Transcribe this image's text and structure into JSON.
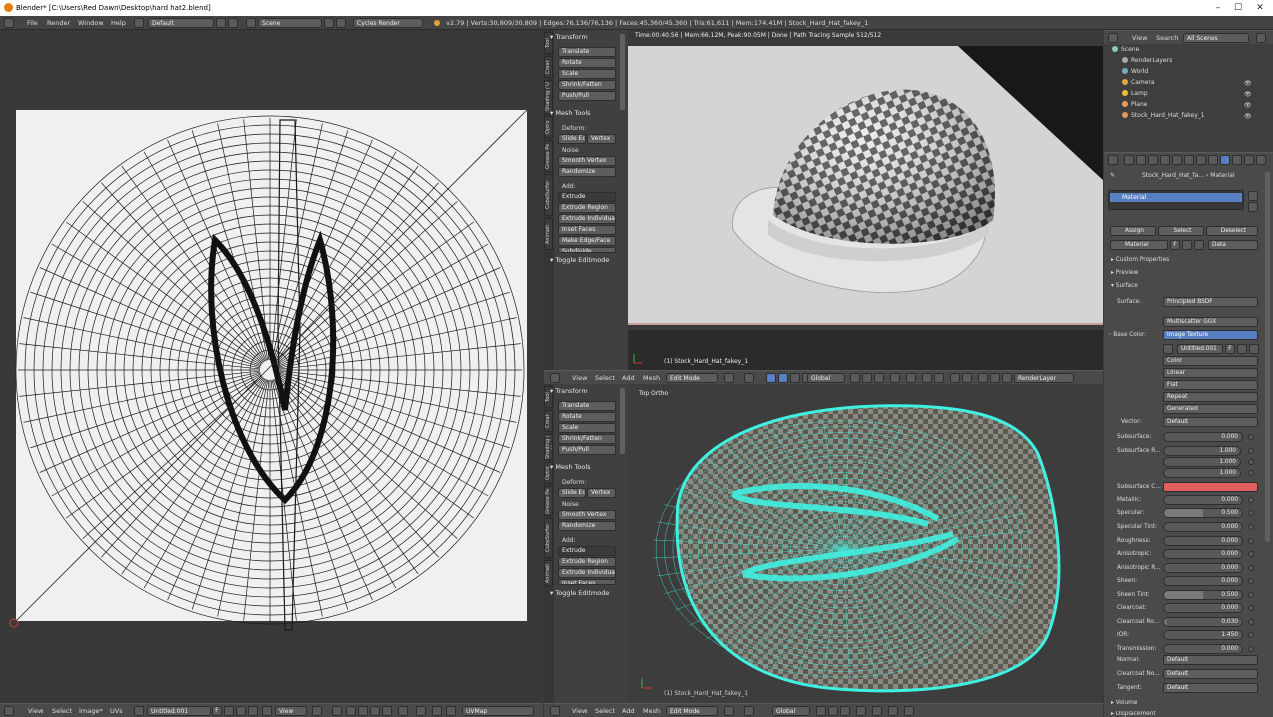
{
  "window": {
    "title": "Blender* [C:\\Users\\Red Dawn\\Desktop\\hard hat2.blend]",
    "min": "–",
    "max": "☐",
    "close": "✕"
  },
  "topbar": {
    "menus": [
      "File",
      "Render",
      "Window",
      "Help"
    ],
    "layout": "Default",
    "scene": "Scene",
    "engine": "Cycles Render",
    "stats": "v2.79 | Verts:30,809/30,809 | Edges:76,136/76,136 | Faces:45,360/45,360 | Tris:61,611 | Mem:174.41M | Stock_Hard_Hat_fakey_1"
  },
  "render_view": {
    "status": "Time:00:40.56 | Mem:66.12M, Peak:90.05M | Done | Path Tracing Sample 512/512",
    "object_label": "(1) Stock_Hard_Hat_fakey_1"
  },
  "ortho_view": {
    "view_label": "Top Ortho",
    "object_label": "(1) Stock_Hard_Hat_fakey_1"
  },
  "tool_tabs": [
    "Tool",
    "Creat",
    "Shading / U",
    "Optio",
    "Grease Pe",
    "CubeSurfer",
    "Animati"
  ],
  "toolshelf": {
    "transform": "Transform",
    "translate": "Translate",
    "rotate": "Rotate",
    "scale": "Scale",
    "shrink": "Shrink/Fatten",
    "push": "Push/Pull",
    "mesh_tools": "Mesh Tools",
    "deform": "Deform:",
    "slide_edge": "Slide Ed",
    "vertex": "Vertex",
    "noise": "Noise",
    "smooth": "Smooth Vertex",
    "randomize": "Randomize",
    "add": "Add:",
    "extrude": "Extrude",
    "extrude_region": "Extrude Region",
    "extrude_individual": "Extrude Individual",
    "inset": "Inset Faces",
    "make_edge": "Make Edge/Face",
    "subdivide": "Subdivide",
    "toggle_editmode": "Toggle Editmode"
  },
  "view3d_header": {
    "menus": [
      "View",
      "Select",
      "Add",
      "Mesh"
    ],
    "mode": "Edit Mode",
    "orientation": "Global",
    "layer": "RenderLayer"
  },
  "uv_header": {
    "menus": [
      "View",
      "Select",
      "Image*",
      "UVs"
    ],
    "image": "Untitled.001",
    "f": "F",
    "view": "View",
    "uvmap": "UVMap"
  },
  "outliner": {
    "menus": [
      "View",
      "Search"
    ],
    "filter": "All Scenes",
    "items": [
      "Scene",
      "RenderLayers",
      "World",
      "Camera",
      "Lamp",
      "Plane",
      "Stock_Hard_Hat_fakey_1"
    ]
  },
  "properties": {
    "breadcrumb": [
      "Stock_Hard_Hat_fa...",
      "Material"
    ],
    "slot": "Material",
    "assign": "Assign",
    "select": "Select",
    "deselect": "Deselect",
    "material_name": "Material",
    "f": "F",
    "data": "Data",
    "custom_properties": "Custom Properties",
    "preview": "Preview",
    "surface_panel": "Surface",
    "surface_label": "Surface:",
    "surface_value": "Principled BSDF",
    "distribution": "Multiscatter GGX",
    "base_color_label": "Base Color:",
    "base_color_value": "Image Texture",
    "image_name": "Untitled.001",
    "img_f": "F",
    "color": "Color",
    "linear": "Linear",
    "flat": "Flat",
    "repeat": "Repeat",
    "generated": "Generated",
    "vector_label": "Vector:",
    "vector_value": "Default",
    "rows": [
      {
        "label": "Subsurface:",
        "value": "0.000",
        "fill": 0
      },
      {
        "label": "Subsurface R...",
        "value": "1.000",
        "fill": 0
      },
      {
        "label": "",
        "value": "1.000",
        "fill": 0
      },
      {
        "label": "",
        "value": "1.000",
        "fill": 0
      },
      {
        "label": "Subsurface C...",
        "value": "",
        "fill": 0
      },
      {
        "label": "Metallic:",
        "value": "0.000",
        "fill": 0
      },
      {
        "label": "Specular:",
        "value": "0.500",
        "fill": 0.5
      },
      {
        "label": "Specular Tint:",
        "value": "0.000",
        "fill": 0
      },
      {
        "label": "Roughness:",
        "value": "0.000",
        "fill": 0
      },
      {
        "label": "Anisotropic:",
        "value": "0.000",
        "fill": 0
      },
      {
        "label": "Anisotropic R...",
        "value": "0.000",
        "fill": 0
      },
      {
        "label": "Sheen:",
        "value": "0.000",
        "fill": 0
      },
      {
        "label": "Sheen Tint:",
        "value": "0.500",
        "fill": 0.5
      },
      {
        "label": "Clearcoat:",
        "value": "0.000",
        "fill": 0
      },
      {
        "label": "Clearcoat Ro...",
        "value": "0.030",
        "fill": 0.03
      },
      {
        "label": "IOR:",
        "value": "1.450",
        "fill": 0
      },
      {
        "label": "Transmission:",
        "value": "0.000",
        "fill": 0
      }
    ],
    "normal_label": "Normal:",
    "normal_value": "Default",
    "clearcoat_normal_label": "Clearcoat No...",
    "clearcoat_normal_value": "Default",
    "tangent_label": "Tangent:",
    "tangent_value": "Default",
    "volume": "Volume",
    "displacement": "Displacement"
  },
  "colors": {
    "accent": "#5680c2",
    "subsurface_color": "#e06060",
    "wire": "#40f0e0"
  }
}
